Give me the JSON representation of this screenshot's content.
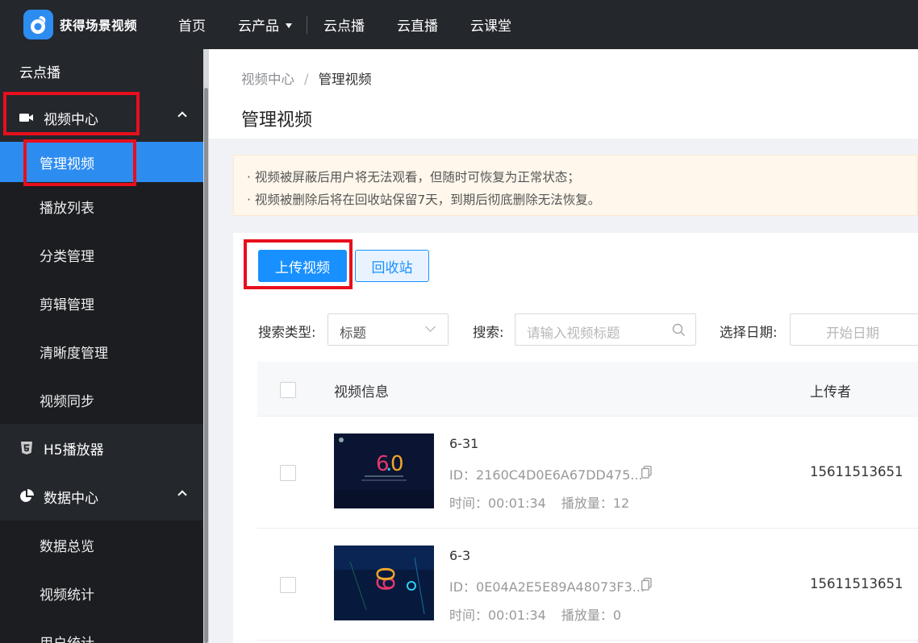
{
  "brand": {
    "name": "获得场景视频"
  },
  "topnav": {
    "home": "首页",
    "products": "云产品",
    "vod": "云点播",
    "live": "云直播",
    "classroom": "云课堂"
  },
  "sidebar": {
    "section_title": "云点播",
    "video_center": {
      "label": "视频中心",
      "items": [
        "管理视频",
        "播放列表",
        "分类管理",
        "剪辑管理",
        "清晰度管理",
        "视频同步"
      ]
    },
    "h5_player": {
      "label": "H5播放器"
    },
    "data_center": {
      "label": "数据中心",
      "items": [
        "数据总览",
        "视频统计",
        "用户统计"
      ]
    }
  },
  "breadcrumb": {
    "parent": "视频中心",
    "separator": "/",
    "current": "管理视频"
  },
  "page_title": "管理视频",
  "notice": {
    "line1": "· 视频被屏蔽后用户将无法观看，但随时可恢复为正常状态；",
    "line2": "· 视频被删除后将在回收站保留7天，到期后彻底删除无法恢复。"
  },
  "actions": {
    "upload": "上传视频",
    "recycle": "回收站"
  },
  "filters": {
    "search_type_label": "搜索类型:",
    "search_type_value": "标题",
    "search_label": "搜索:",
    "search_placeholder": "请输入视频标题",
    "date_label": "选择日期:",
    "start_date_placeholder": "开始日期",
    "date_separator": "~"
  },
  "table": {
    "headers": {
      "info": "视频信息",
      "uploader": "上传者"
    },
    "rows": [
      {
        "title": "6-31",
        "id": "ID：2160C4D0E6A67DD475...",
        "duration": "时间：00:01:34",
        "plays": "播放量：12",
        "uploader": "15611513651"
      },
      {
        "title": "6-3",
        "id": "ID：0E04A2E5E89A48073F3...",
        "duration": "时间：00:01:34",
        "plays": "播放量：0",
        "uploader": "15611513651"
      }
    ]
  },
  "colors": {
    "accent": "#1890ff",
    "sidebar_bg": "#24272c",
    "highlight_box": "#e80f1c",
    "notice_bg": "#fff7ec"
  }
}
